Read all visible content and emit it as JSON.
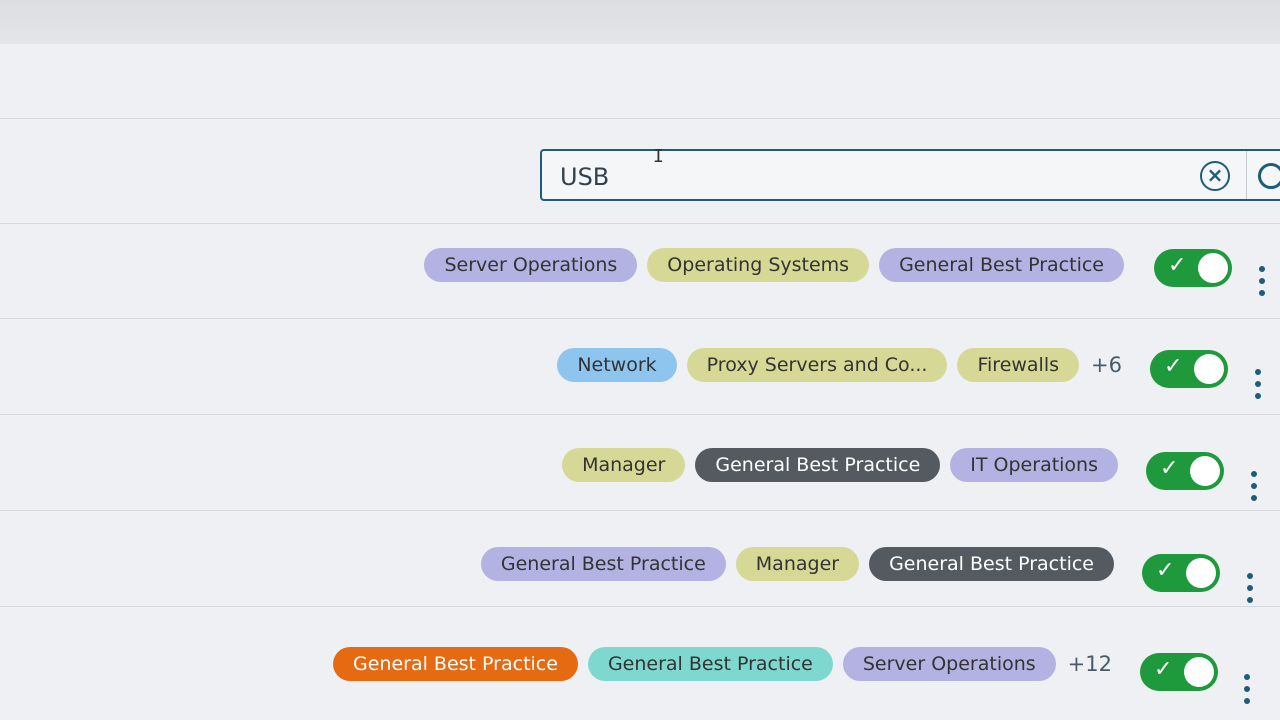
{
  "search": {
    "value": "USB",
    "placeholder": ""
  },
  "icons": {
    "clear": "close-circle-icon",
    "search": "search-icon",
    "toggle_check": "check-icon",
    "more": "kebab-menu-icon"
  },
  "colors": {
    "accent": "#1e5d7a",
    "toggle_on": "#1e9a3c",
    "tag_purple": "#b4b2e2",
    "tag_olive": "#d6d996",
    "tag_blue": "#8ec5ef",
    "tag_dark": "#545a60",
    "tag_orange": "#e56a12",
    "tag_teal": "#7fd8cf"
  },
  "rows": [
    {
      "tags": [
        "Server Operations",
        "Operating Systems",
        "General Best Practice"
      ],
      "more": "",
      "enabled": true
    },
    {
      "tags": [
        "Network",
        "Proxy Servers and Co...",
        "Firewalls"
      ],
      "more": "+6",
      "enabled": true
    },
    {
      "tags": [
        "Manager",
        "General Best Practice",
        "IT Operations"
      ],
      "more": "",
      "enabled": true
    },
    {
      "tags": [
        "General Best Practice",
        "Manager",
        "General Best Practice"
      ],
      "more": "",
      "enabled": true
    },
    {
      "tags": [
        "General Best Practice",
        "General Best Practice",
        "Server Operations"
      ],
      "more": "+12",
      "enabled": true
    }
  ]
}
